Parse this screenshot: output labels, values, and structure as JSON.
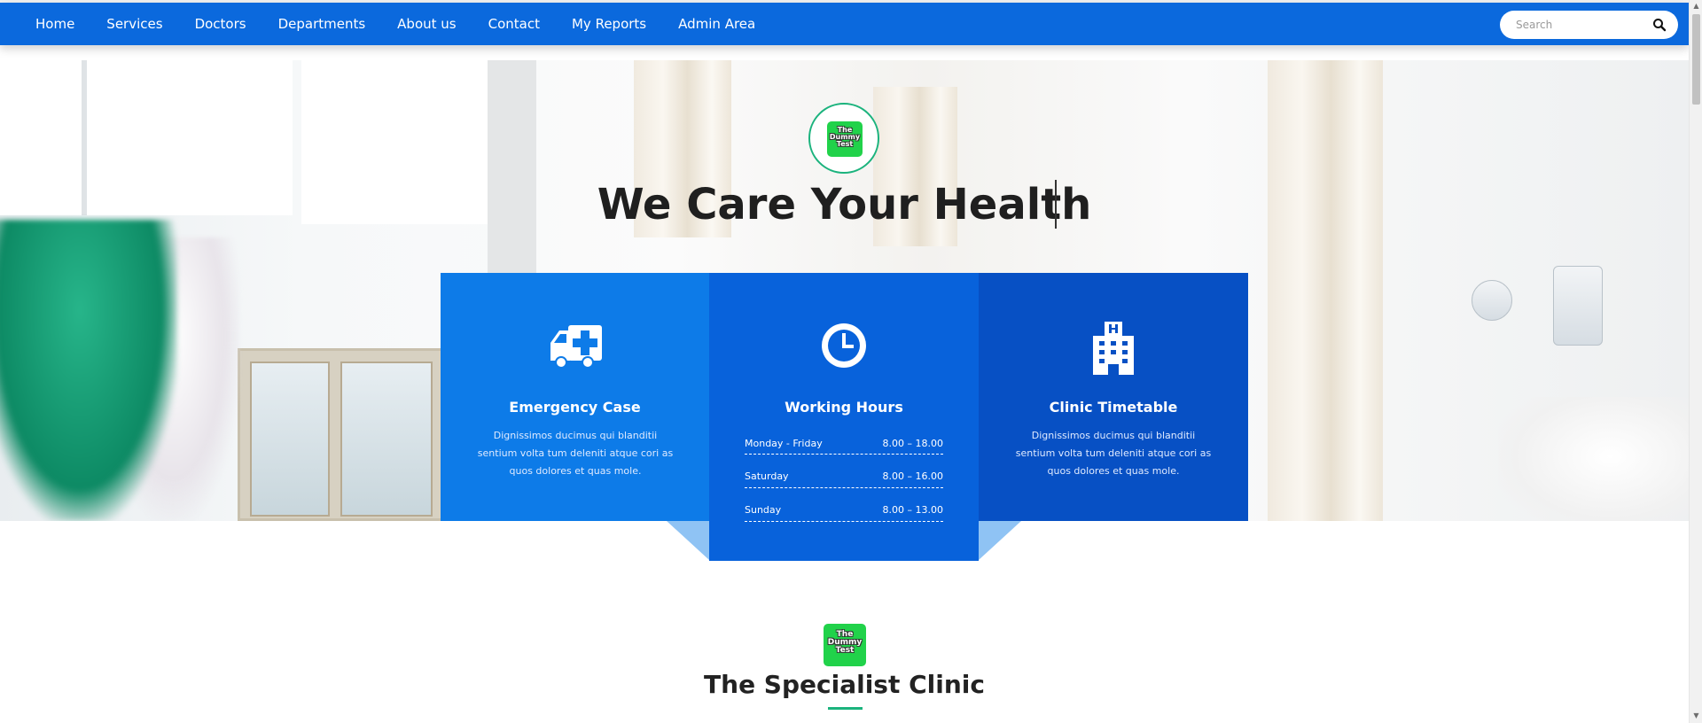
{
  "nav": {
    "items": [
      "Home",
      "Services",
      "Doctors",
      "Departments",
      "About us",
      "Contact",
      "My Reports",
      "Admin Area"
    ],
    "search_placeholder": "Search"
  },
  "hero": {
    "logo_text": "The Dummy Test",
    "title": "We Care Your Health"
  },
  "cards": {
    "emergency": {
      "title": "Emergency Case",
      "text": "Dignissimos ducimus qui blanditii sentium volta tum deleniti atque cori as quos dolores et quas mole.",
      "icon": "ambulance-icon"
    },
    "hours": {
      "title": "Working Hours",
      "icon": "clock-icon",
      "rows": [
        {
          "day": "Monday - Friday",
          "time": "8.00 – 18.00"
        },
        {
          "day": "Saturday",
          "time": "8.00 – 16.00"
        },
        {
          "day": "Sunday",
          "time": "8.00 – 13.00"
        }
      ]
    },
    "timetable": {
      "title": "Clinic Timetable",
      "text": "Dignissimos ducimus qui blanditii sentium volta tum deleniti atque cori as quos dolores et quas mole.",
      "icon": "hospital-icon"
    }
  },
  "specialist": {
    "logo_text": "The Dummy Test",
    "title": "The Specialist Clinic"
  },
  "colors": {
    "nav": "#0b69dd",
    "card_1": "#0d7be8",
    "card_2": "#0862db",
    "card_3": "#0750c4",
    "accent_green": "#1bb37d",
    "logo_green": "#21d24a"
  }
}
